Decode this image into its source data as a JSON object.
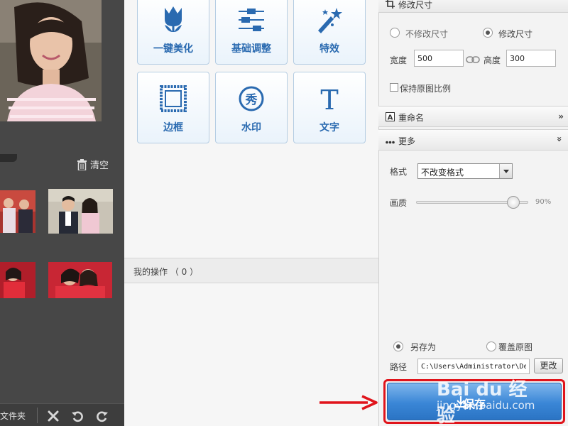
{
  "left_panel": {
    "clear_label": "清空",
    "folder_label": "文件夹"
  },
  "tools": [
    {
      "label": "一键美化",
      "icon": "tulip-icon"
    },
    {
      "label": "基础调整",
      "icon": "sliders-icon"
    },
    {
      "label": "特效",
      "icon": "magic-wand-icon"
    },
    {
      "label": "边框",
      "icon": "frame-icon"
    },
    {
      "label": "水印",
      "icon": "watermark-badge-icon"
    },
    {
      "label": "文字",
      "icon": "text-t-icon"
    }
  ],
  "watermark_badge_char": "秀",
  "text_icon_char": "T",
  "operations": {
    "label": "我的操作 （ 0 ）"
  },
  "resize": {
    "title": "修改尺寸",
    "option_keep": "不修改尺寸",
    "option_change": "修改尺寸",
    "selected": "修改尺寸",
    "width_label": "宽度",
    "width_value": "500",
    "height_label": "高度",
    "height_value": "300",
    "keep_ratio_label": "保持原图比例",
    "keep_ratio_checked": false
  },
  "rename": {
    "title": "重命名",
    "icon_char": "A"
  },
  "more": {
    "title": "更多",
    "format_label": "格式",
    "format_value": "不改变格式",
    "quality_label": "画质",
    "quality_value": "90%",
    "quality_level": 0.9
  },
  "save_options": {
    "save_as_label": "另存为",
    "overwrite_label": "覆盖原图",
    "selected": "另存为",
    "path_label": "路径",
    "path_value": "C:\\Users\\Administrator\\Desktop",
    "change_label": "更改"
  },
  "save_button": {
    "label": "保存"
  },
  "watermark": {
    "main": "Bai du 经验",
    "sub": "jingyan.baidu.com"
  },
  "colors": {
    "accent": "#2a6ab0",
    "highlight_red": "#e0141b",
    "save_blue": "#3a86d6"
  }
}
